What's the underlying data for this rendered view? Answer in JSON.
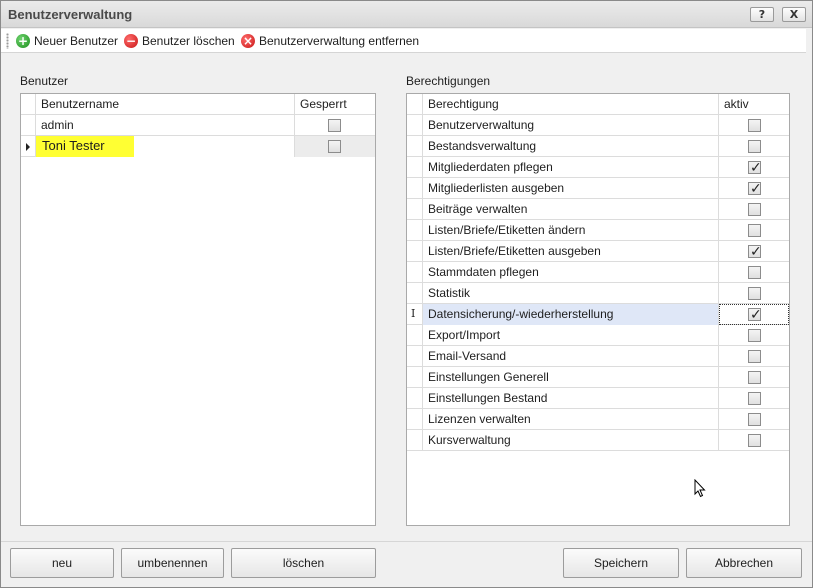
{
  "window": {
    "title": "Benutzerverwaltung",
    "help_label": "?",
    "close_label": "X"
  },
  "toolbar": {
    "new_user": "Neuer Benutzer",
    "delete_user": "Benutzer löschen",
    "remove_admin": "Benutzerverwaltung entfernen"
  },
  "users": {
    "group_label": "Benutzer",
    "columns": [
      "Benutzername",
      "Gesperrt"
    ],
    "rows": [
      {
        "name": "admin",
        "locked": false
      },
      {
        "name": "Toni Tester",
        "locked": false
      }
    ]
  },
  "permissions": {
    "group_label": "Berechtigungen",
    "columns": [
      "Berechtigung",
      "aktiv"
    ],
    "rows": [
      {
        "name": "Benutzerverwaltung",
        "active": false
      },
      {
        "name": "Bestandsverwaltung",
        "active": false
      },
      {
        "name": "Mitgliederdaten pflegen",
        "active": true
      },
      {
        "name": "Mitgliederlisten ausgeben",
        "active": true
      },
      {
        "name": "Beiträge verwalten",
        "active": false
      },
      {
        "name": "Listen/Briefe/Etiketten ändern",
        "active": false
      },
      {
        "name": "Listen/Briefe/Etiketten ausgeben",
        "active": true
      },
      {
        "name": "Stammdaten pflegen",
        "active": false
      },
      {
        "name": "Statistik",
        "active": false
      },
      {
        "name": "Datensicherung/-wiederherstellung",
        "active": true
      },
      {
        "name": "Export/Import",
        "active": false
      },
      {
        "name": "Email-Versand",
        "active": false
      },
      {
        "name": "Einstellungen Generell",
        "active": false
      },
      {
        "name": "Einstellungen Bestand",
        "active": false
      },
      {
        "name": "Lizenzen verwalten",
        "active": false
      },
      {
        "name": "Kursverwaltung",
        "active": false
      }
    ]
  },
  "buttons": {
    "neu": "neu",
    "umbenennen": "umbenennen",
    "loeschen": "löschen",
    "speichern": "Speichern",
    "abbrechen": "Abbrechen"
  },
  "colors": {
    "highlight": "#ffff33",
    "focus_row": "#dfe7f7"
  },
  "icons": {
    "new_user": "plus-circle-icon",
    "delete_user": "minus-circle-icon",
    "remove_admin": "x-circle-icon"
  }
}
